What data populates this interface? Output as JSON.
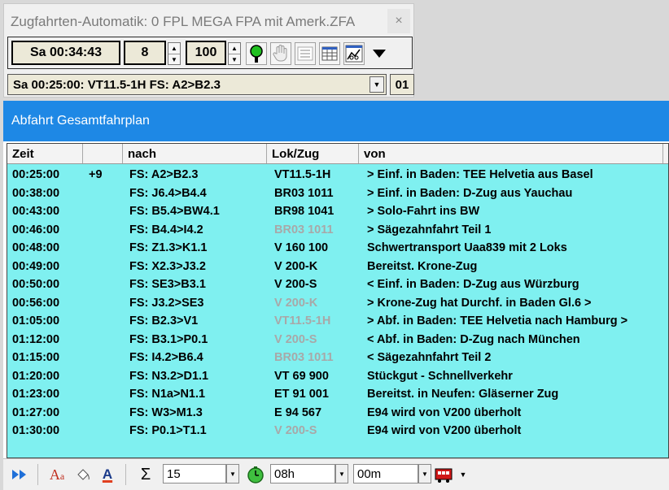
{
  "control_window": {
    "title": "Zugfahrten-Automatik: 0 FPL MEGA FPA mit Amerk.ZFA",
    "close_glyph": "×",
    "clock": "Sa  00:34:43",
    "speed": "8",
    "percent": "100",
    "status_text": "Sa 00:25:00: VT11.5-1H FS: A2>B2.3",
    "status_count": "01",
    "icons": [
      "signal-green-icon",
      "hand-icon",
      "list-icon",
      "table-icon",
      "chart-icon",
      "dropdown-triangle-icon"
    ]
  },
  "main_window": {
    "title": "Abfahrt Gesamtfahrplan",
    "columns": [
      "Zeit",
      "",
      "nach",
      "Lok/Zug",
      "von"
    ],
    "rows": [
      {
        "zeit": "00:25:00",
        "delay": "+9",
        "nach": "FS: A2>B2.3",
        "lok": "VT11.5-1H",
        "lok_dim": false,
        "von": "> Einf. in Baden: TEE Helvetia aus Basel"
      },
      {
        "zeit": "00:38:00",
        "delay": "",
        "nach": "FS: J6.4>B4.4",
        "lok": "BR03 1011",
        "lok_dim": false,
        "von": "> Einf. in Baden: D-Zug aus Yauchau"
      },
      {
        "zeit": "00:43:00",
        "delay": "",
        "nach": "FS: B5.4>BW4.1",
        "lok": "BR98 1041",
        "lok_dim": false,
        "von": "> Solo-Fahrt ins BW"
      },
      {
        "zeit": "00:46:00",
        "delay": "",
        "nach": "FS: B4.4>I4.2",
        "lok": "BR03 1011",
        "lok_dim": true,
        "von": "> Sägezahnfahrt Teil 1"
      },
      {
        "zeit": "00:48:00",
        "delay": "",
        "nach": "FS: Z1.3>K1.1",
        "lok": "V 160 100",
        "lok_dim": false,
        "von": "Schwertransport Uaa839 mit 2 Loks"
      },
      {
        "zeit": "00:49:00",
        "delay": "",
        "nach": "FS: X2.3>J3.2",
        "lok": "V 200-K",
        "lok_dim": false,
        "von": "Bereitst. Krone-Zug"
      },
      {
        "zeit": "00:50:00",
        "delay": "",
        "nach": "FS: SE3>B3.1",
        "lok": "V 200-S",
        "lok_dim": false,
        "von": "< Einf. in Baden: D-Zug aus Würzburg"
      },
      {
        "zeit": "00:56:00",
        "delay": "",
        "nach": "FS: J3.2>SE3",
        "lok": "V 200-K",
        "lok_dim": true,
        "von": "> Krone-Zug hat Durchf. in Baden Gl.6 >"
      },
      {
        "zeit": "01:05:00",
        "delay": "",
        "nach": "FS: B2.3>V1",
        "lok": "VT11.5-1H",
        "lok_dim": true,
        "von": "> Abf. in Baden: TEE Helvetia nach Hamburg >"
      },
      {
        "zeit": "01:12:00",
        "delay": "",
        "nach": "FS: B3.1>P0.1",
        "lok": "V 200-S",
        "lok_dim": true,
        "von": "< Abf. in Baden: D-Zug nach München"
      },
      {
        "zeit": "01:15:00",
        "delay": "",
        "nach": "FS: I4.2>B6.4",
        "lok": "BR03 1011",
        "lok_dim": true,
        "von": "< Sägezahnfahrt Teil 2"
      },
      {
        "zeit": "01:20:00",
        "delay": "",
        "nach": "FS: N3.2>D1.1",
        "lok": "VT 69 900",
        "lok_dim": false,
        "von": "Stückgut - Schnellverkehr"
      },
      {
        "zeit": "01:23:00",
        "delay": "",
        "nach": "FS: N1a>N1.1",
        "lok": "ET 91 001",
        "lok_dim": false,
        "von": "Bereitst. in Neufen: Gläserner Zug"
      },
      {
        "zeit": "01:27:00",
        "delay": "",
        "nach": "FS: W3>M1.3",
        "lok": "E 94 567",
        "lok_dim": false,
        "von": "E94 wird von V200 überholt"
      },
      {
        "zeit": "01:30:00",
        "delay": "",
        "nach": "FS: P0.1>T1.1",
        "lok": "V 200-S",
        "lok_dim": true,
        "von": "E94 wird von V200 überholt"
      }
    ]
  },
  "bottom_bar": {
    "sum_glyph": "Σ",
    "count_value": "15",
    "hours_value": "08h",
    "minutes_value": "00m"
  },
  "colors": {
    "title_bar": "#1e88e5",
    "grid_bg": "#7ff0f0",
    "dim_text": "#a8a8a8"
  }
}
